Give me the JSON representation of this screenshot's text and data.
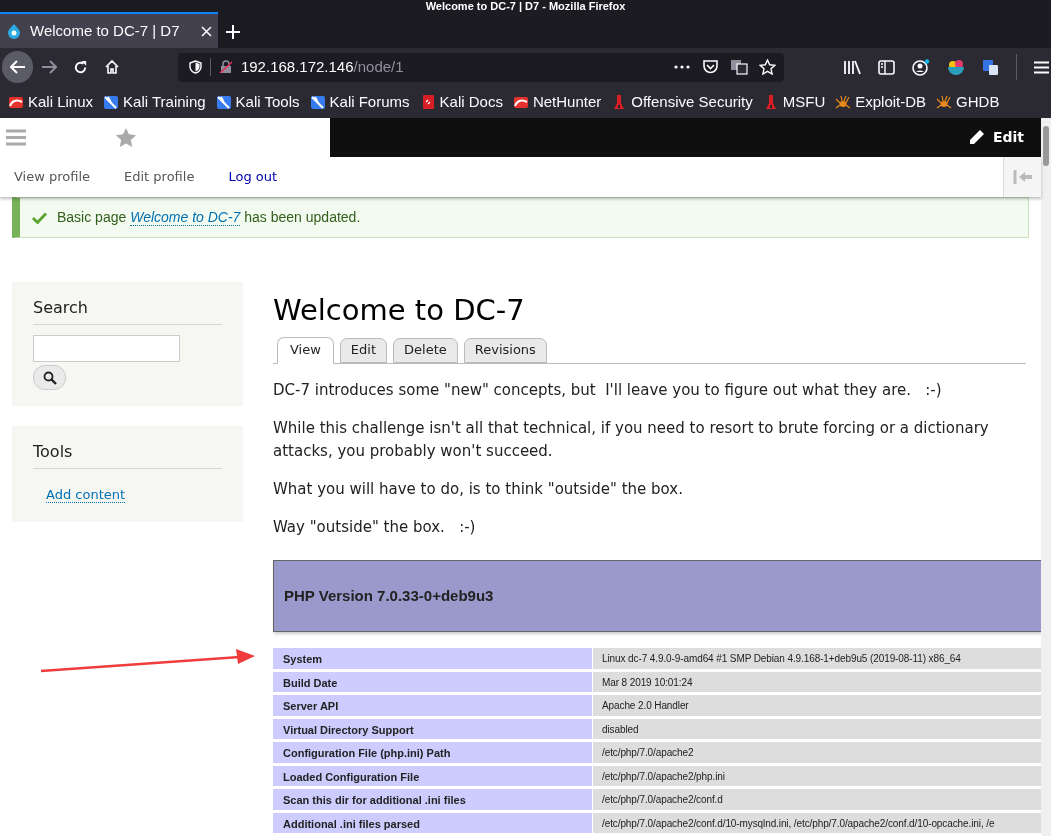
{
  "window": {
    "title": "Welcome to DC-7 | D7 - Mozilla Firefox"
  },
  "tabs": [
    {
      "title": "Welcome to DC-7 | D7",
      "selected": true
    }
  ],
  "address_bar": {
    "host": "192.168.172.146",
    "path": "/node/1"
  },
  "bookmarks": [
    {
      "label": "Kali Linux",
      "kind": "kali"
    },
    {
      "label": "Kali Training",
      "kind": "dragon"
    },
    {
      "label": "Kali Tools",
      "kind": "dragon"
    },
    {
      "label": "Kali Forums",
      "kind": "dragon"
    },
    {
      "label": "Kali Docs",
      "kind": "docs"
    },
    {
      "label": "NetHunter",
      "kind": "kali"
    },
    {
      "label": "Offensive Security",
      "kind": "offsec"
    },
    {
      "label": "MSFU",
      "kind": "offsec"
    },
    {
      "label": "Exploit-DB",
      "kind": "spider"
    },
    {
      "label": "GHDB",
      "kind": "spider"
    }
  ],
  "admin_toolbar": {
    "edit_label": "Edit",
    "user_links": [
      {
        "label": "View profile",
        "kind": "plain"
      },
      {
        "label": "Edit profile",
        "kind": "plain"
      },
      {
        "label": "Log out",
        "kind": "link"
      }
    ]
  },
  "message": {
    "prefix": "Basic page",
    "link": "Welcome to DC-7",
    "suffix": "has been updated."
  },
  "sidebar": [
    {
      "title": "Search",
      "kind": "search"
    },
    {
      "title": "Tools",
      "kind": "links",
      "links": [
        "Add content"
      ]
    }
  ],
  "page": {
    "title": "Welcome to DC-7",
    "tabs": [
      {
        "label": "View",
        "selected": true
      },
      {
        "label": "Edit",
        "selected": false
      },
      {
        "label": "Delete",
        "selected": false
      },
      {
        "label": "Revisions",
        "selected": false
      }
    ],
    "paragraphs": [
      "DC-7 introduces some \"new\" concepts, but  I'll leave you to figure out what they are.   :-)",
      "While this challenge isn't all that technical, if you need to resort to brute forcing or a dictionary attacks, you probably won't succeed.",
      "What you will have to do, is to think \"outside\" the box.",
      "Way \"outside\" the box.   :-)"
    ]
  },
  "phpinfo": {
    "version": "PHP Version 7.0.33-0+deb9u3",
    "rows": [
      {
        "label": "System",
        "value": "Linux dc-7 4.9.0-9-amd64 #1 SMP Debian 4.9.168-1+deb9u5 (2019-08-11) x86_64"
      },
      {
        "label": "Build Date",
        "value": "Mar 8 2019 10:01:24"
      },
      {
        "label": "Server API",
        "value": "Apache 2.0 Handler"
      },
      {
        "label": "Virtual Directory Support",
        "value": "disabled"
      },
      {
        "label": "Configuration File (php.ini) Path",
        "value": "/etc/php/7.0/apache2"
      },
      {
        "label": "Loaded Configuration File",
        "value": "/etc/php/7.0/apache2/php.ini"
      },
      {
        "label": "Scan this dir for additional .ini files",
        "value": "/etc/php/7.0/apache2/conf.d"
      },
      {
        "label": "Additional .ini files parsed",
        "value": "/etc/php/7.0/apache2/conf.d/10-mysqlnd.ini, /etc/php/7.0/apache2/conf.d/10-opcache.ini, /e"
      }
    ]
  }
}
